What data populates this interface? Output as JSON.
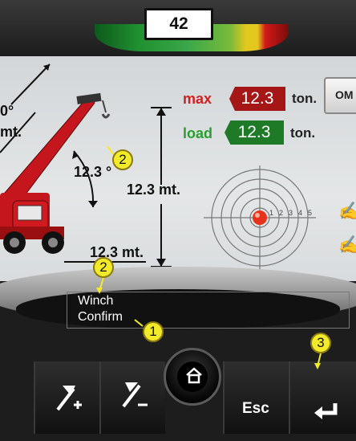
{
  "header": {
    "angle_value": "42"
  },
  "colors": {
    "max_label": "#d32020",
    "load_label": "#27a02d",
    "max_box": "#a51616",
    "load_box": "#1e7a26",
    "badge": "#f3ea2a"
  },
  "load": {
    "max_label": "max",
    "max_value": "12.3",
    "max_unit": "ton.",
    "load_label": "load",
    "load_value": "12.3",
    "load_unit": "ton."
  },
  "side_button": {
    "label": "OM"
  },
  "crane": {
    "angle_partial": "0°",
    "length_partial": "mt.",
    "boom_angle": "12.3 °",
    "height": "12.3 mt.",
    "radius": "12.3 mt."
  },
  "target": {
    "ring_labels": [
      "1",
      "2",
      "3",
      "4",
      "5"
    ]
  },
  "callouts": {
    "badge_1": "1",
    "badge_2a": "2",
    "badge_2b": "2",
    "badge_3": "3"
  },
  "popup": {
    "line1": "Winch",
    "line2": "Confirm"
  },
  "buttons": {
    "esc_label": "Esc"
  },
  "icons": [
    "increase-icon",
    "decrease-icon",
    "home-icon",
    "enter-icon",
    "signature-icon"
  ]
}
